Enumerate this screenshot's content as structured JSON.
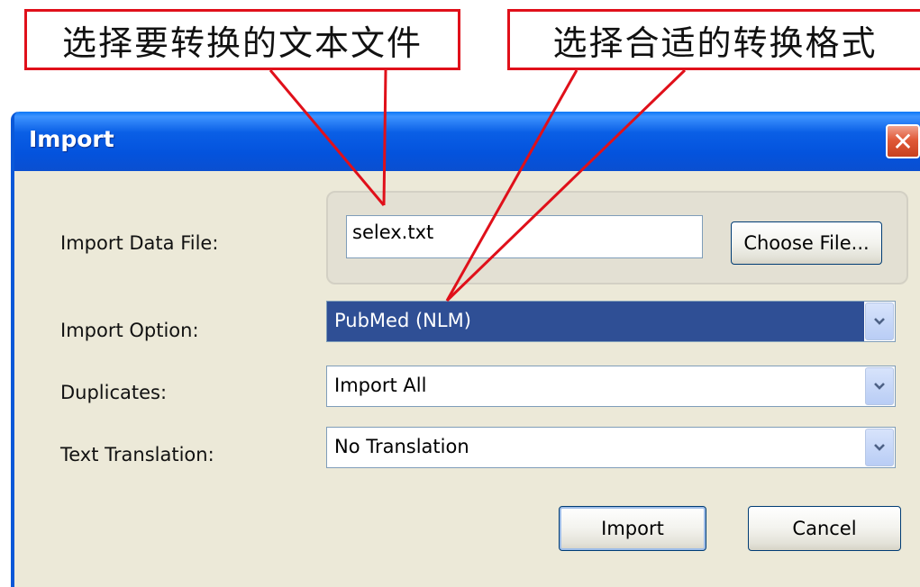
{
  "callouts": {
    "left": "选择要转换的文本文件",
    "right": "选择合适的转换格式"
  },
  "dialog": {
    "title": "Import",
    "close_glyph": "✕",
    "import_file_label": "Import Data File:",
    "import_file_value": "selex.txt",
    "choose_file_label": "Choose File...",
    "import_option_label": "Import Option:",
    "import_option_value": "PubMed (NLM)",
    "duplicates_label": "Duplicates:",
    "duplicates_value": "Import All",
    "text_translation_label": "Text Translation:",
    "text_translation_value": "No Translation",
    "import_button": "Import",
    "cancel_button": "Cancel"
  },
  "colors": {
    "callout_border": "#e0101a",
    "titlebar": "#0453dd",
    "selection": "#2f4f95",
    "dialog_bg": "#ece9d8"
  },
  "icons": {
    "close": "close-icon",
    "dropdown": "chevron-down-icon"
  }
}
